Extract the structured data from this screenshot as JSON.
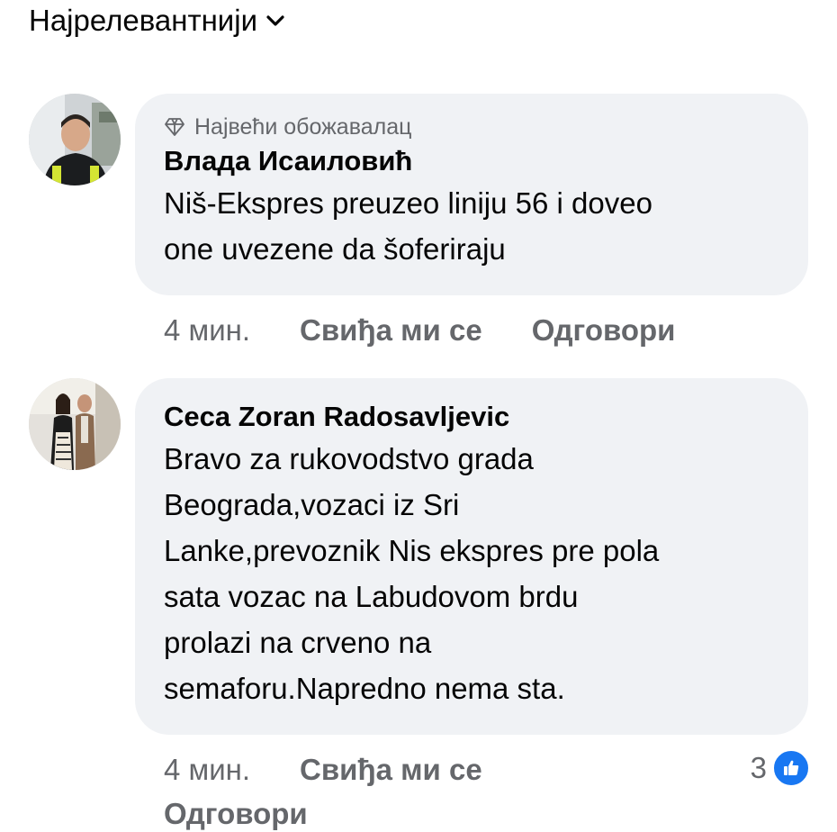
{
  "sort": {
    "label": "Најрелевантнији"
  },
  "comments": [
    {
      "badge": "Највећи обожавалац",
      "author": "Влада Исаиловић",
      "lines": [
        "Niš-Ekspres preuzeo liniju 56 i doveo",
        "one uvezene da šoferiraju"
      ],
      "time": "4 мин.",
      "like_label": "Свиђа ми се",
      "reply_label": "Одговори"
    },
    {
      "author": "Ceca Zoran Radosavljevic",
      "lines": [
        "Bravo za rukovodstvo grada",
        "Beograda,vozaci iz Sri",
        "Lanke,prevoznik Nis ekspres pre pola",
        "sata vozac na Labudovom brdu",
        "prolazi na crveno na",
        "semaforu.Napredno nema sta."
      ],
      "time": "4 мин.",
      "like_label": "Свиђа ми се",
      "reply_label": "Одговори",
      "reaction_count": "3"
    }
  ],
  "colors": {
    "bubble": "#f0f2f5",
    "meta": "#65676b",
    "like_blue": "#1877f2"
  }
}
